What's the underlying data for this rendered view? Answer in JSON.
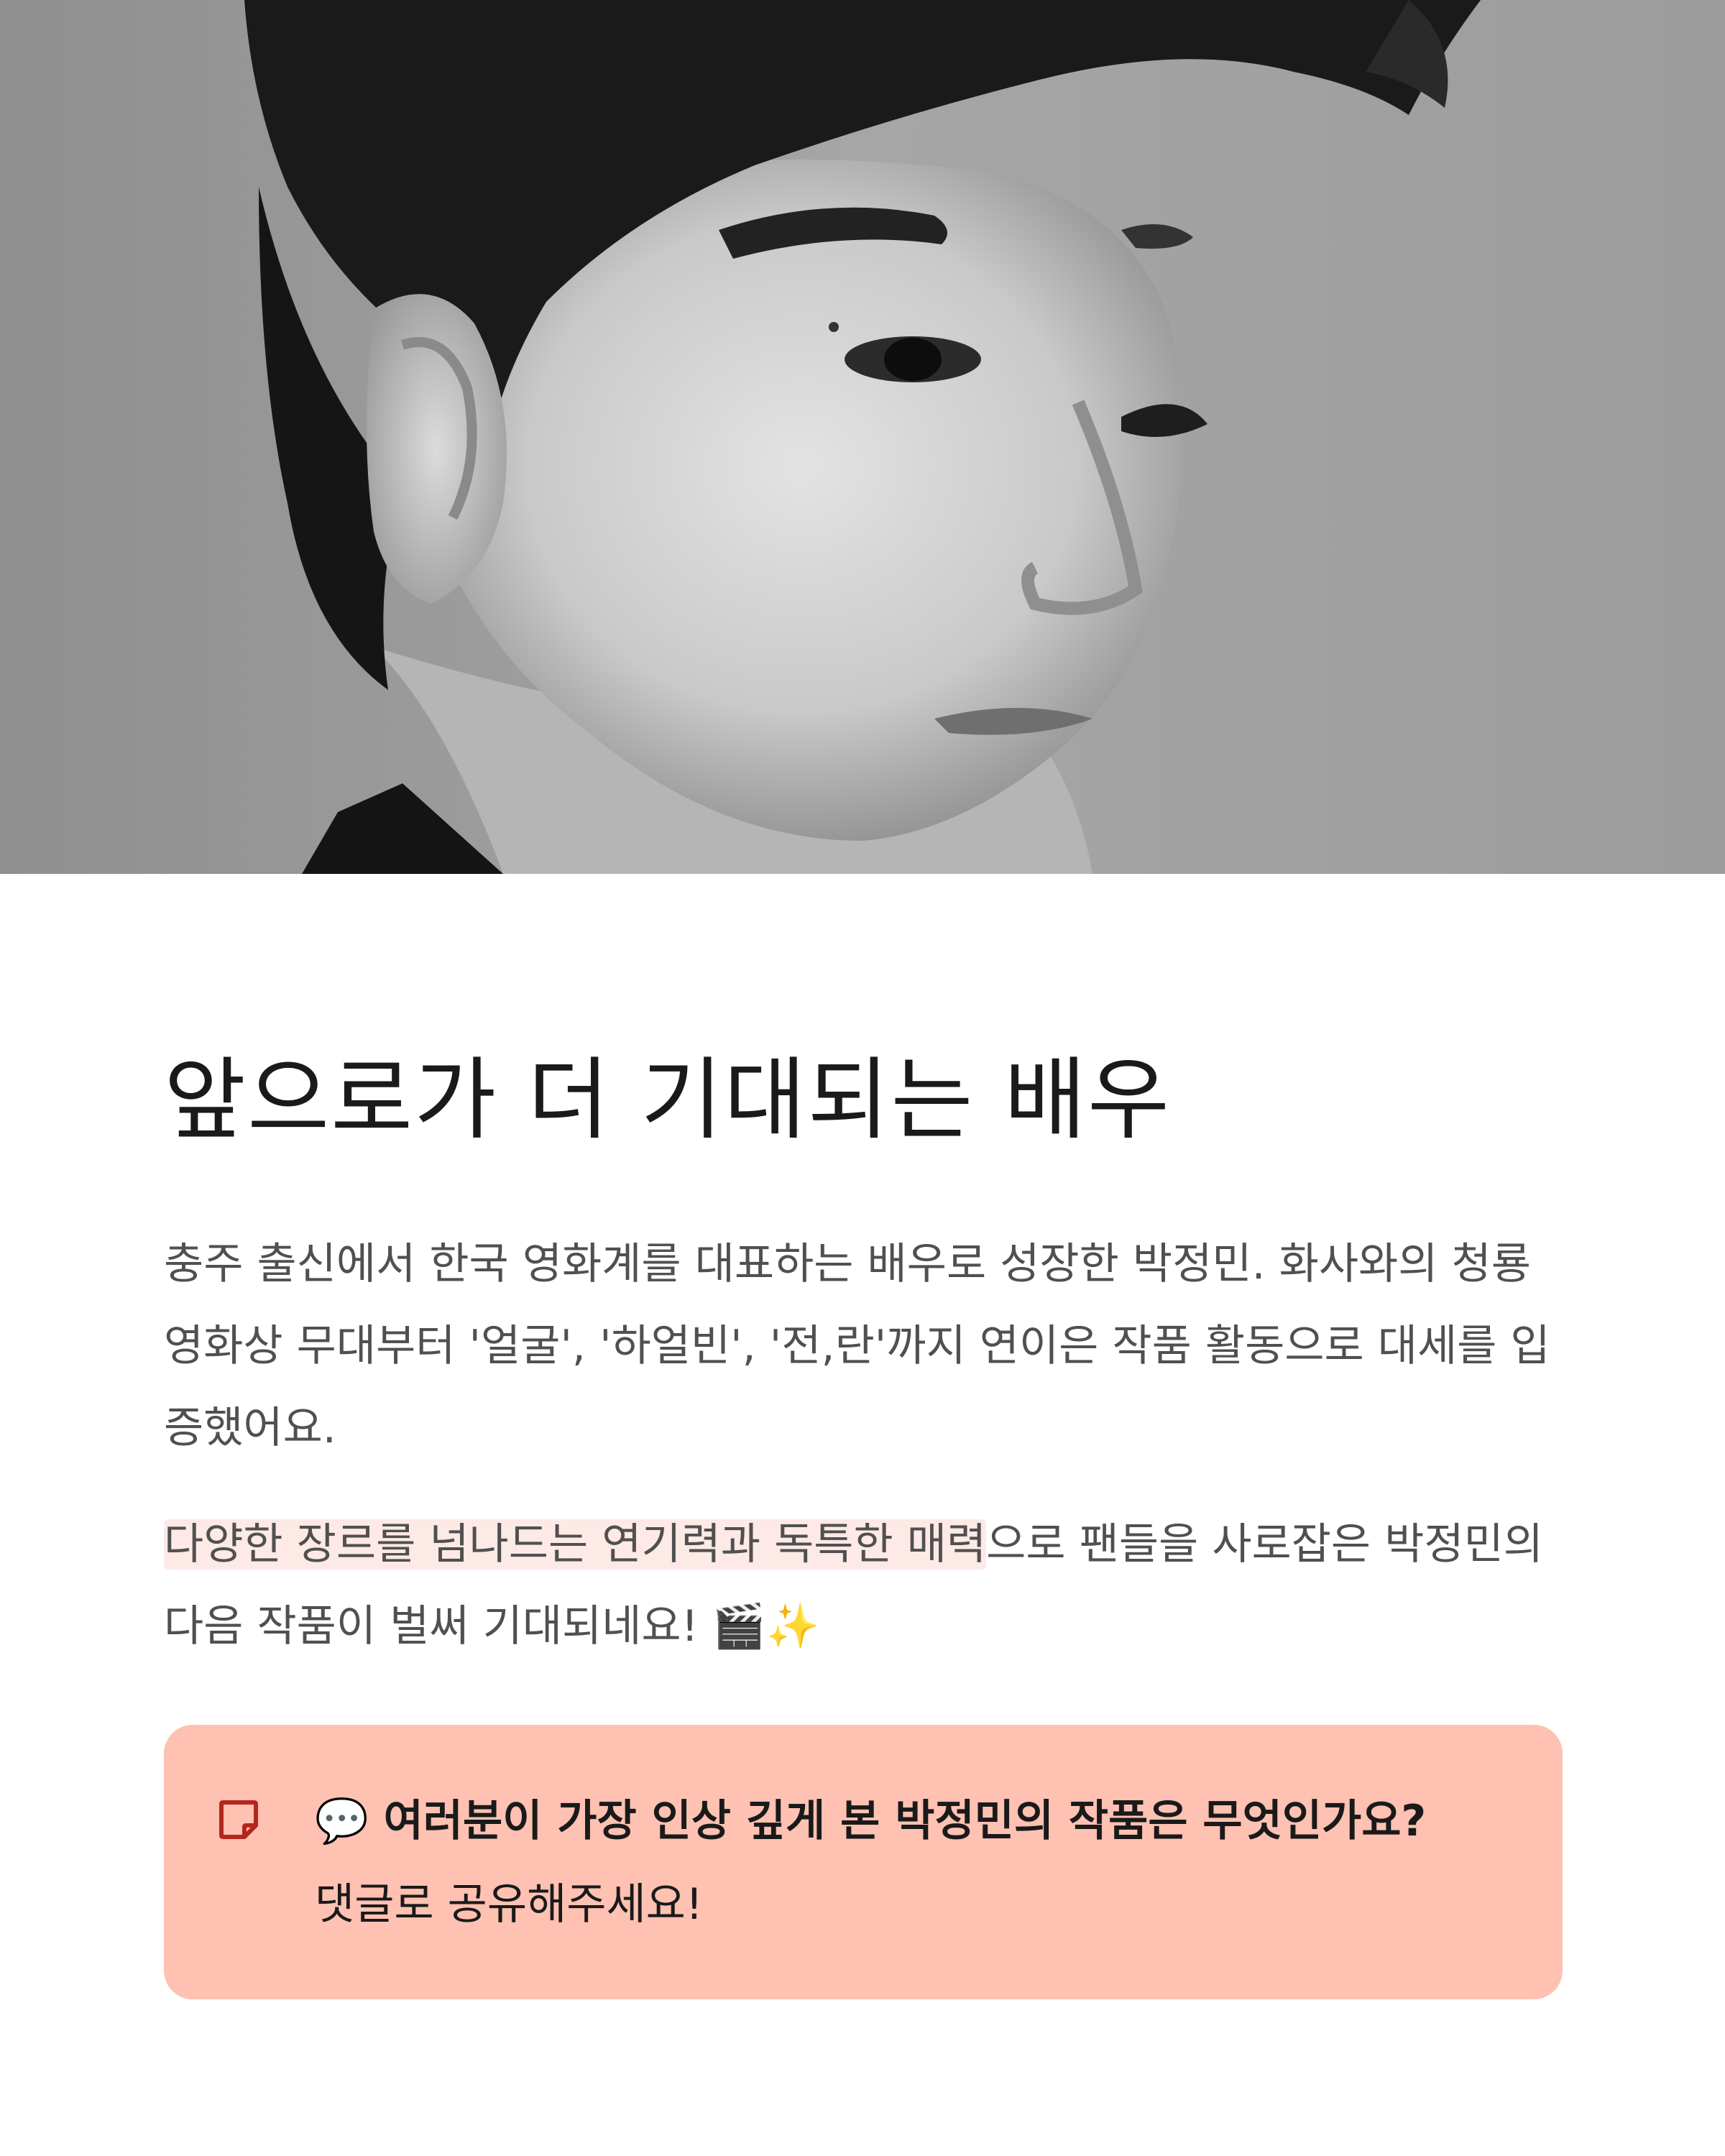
{
  "hero": {
    "image": "black-and-white-portrait-photo"
  },
  "article": {
    "title": "앞으로가 더 기대되는 배우",
    "paragraph_1": "충주 출신에서 한국 영화계를 대표하는 배우로 성장한 박정민. 화사와의 청룡영화상 무대부터 '얼굴', '하얼빈', '전,란'까지 연이은 작품 활동으로 대세를 입증했어요.",
    "paragraph_2_highlight": "다양한 장르를 넘나드는 연기력과 독특한 매력",
    "paragraph_2_rest": "으로 팬들을 사로잡은 박정민의 다음 작품이 벌써 기대되네요! ",
    "paragraph_2_emoji": "🎬✨"
  },
  "callout": {
    "icon": "note-icon",
    "heading": "💬 여러분이 가장 인상 깊게 본 박정민의 작품은 무엇인가요?",
    "subtext": "댓글로 공유해주세요!",
    "background": "#fec1b2",
    "icon_color": "#b3261e"
  },
  "colors": {
    "highlight": "#fde9e6",
    "body_text": "#505050",
    "title_text": "#1a1a1a"
  }
}
